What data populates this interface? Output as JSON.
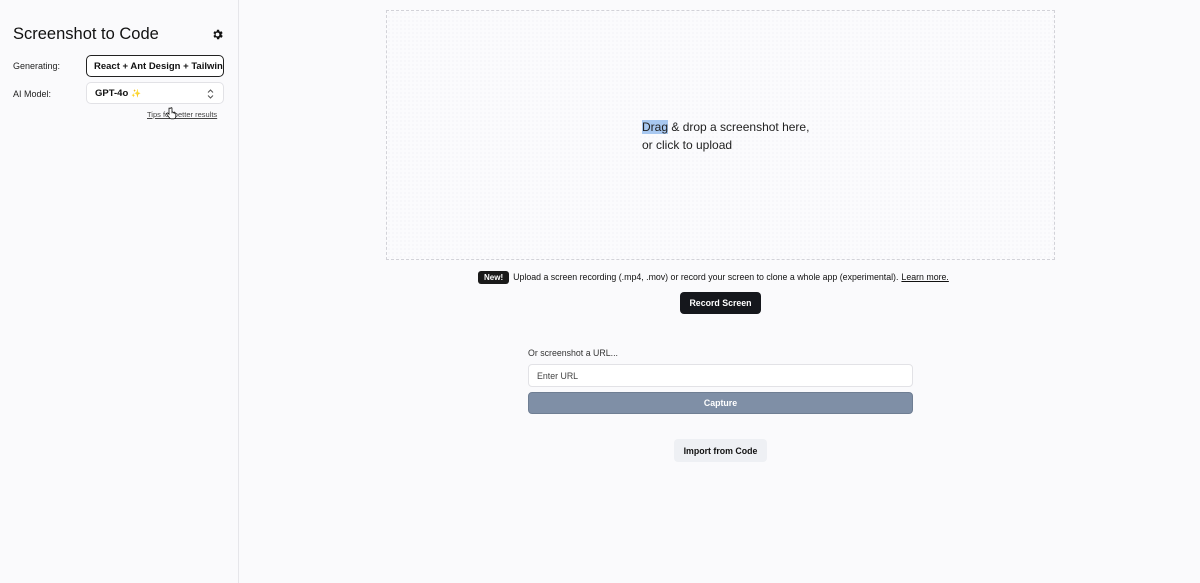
{
  "sidebar": {
    "title": "Screenshot to Code",
    "generating_label": "Generating:",
    "generating_value": "React + Ant Design + Tailwind",
    "model_label": "AI Model:",
    "model_value": "GPT-4o",
    "model_icon": "sparkle-icon",
    "tips_link": "Tips for better results"
  },
  "dropzone": {
    "highlight": "Drag",
    "line1_rest": " & drop a screenshot here,",
    "line2": "or click to upload"
  },
  "recording": {
    "badge": "New!",
    "text": "Upload a screen recording (.mp4, .mov) or record your screen to clone a whole app (experimental).",
    "learn_more": "Learn more.",
    "record_button": "Record Screen"
  },
  "url_capture": {
    "label": "Or screenshot a URL...",
    "placeholder": "Enter URL",
    "capture_button": "Capture"
  },
  "import_button": "Import from Code",
  "colors": {
    "record_button_bg": "#15171c",
    "capture_button_bg": "#7f8fa6",
    "highlight": "#a8c8f0"
  }
}
